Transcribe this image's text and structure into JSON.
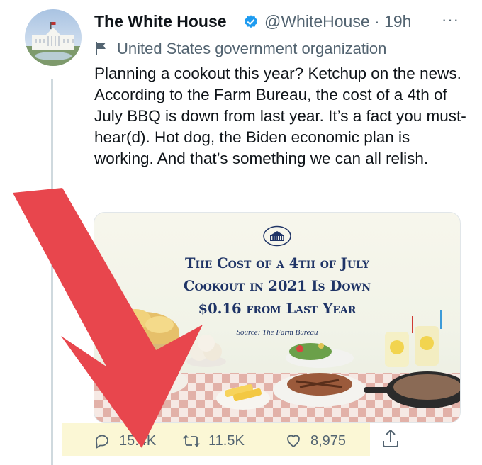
{
  "tweet": {
    "author_name": "The White House",
    "handle": "@WhiteHouse",
    "separator": "·",
    "time": "19h",
    "more_label": "···",
    "account_label": "United States government organization",
    "text": "Planning a cookout this year? Ketchup on the news. According to the Farm Bureau, the cost of a 4th of July BBQ is down from last year. It’s a fact you must-hear(d). Hot dog, the Biden economic plan is working. And that’s something we can all relish."
  },
  "media": {
    "headline_line1": "The Cost of a 4th of July",
    "headline_line2": "Cookout in 2021 Is Down",
    "headline_line3": "$0.16 from Last Year",
    "source_label": "Source:",
    "source_value": "The Farm Bureau"
  },
  "actions": {
    "replies": "15.4K",
    "retweets": "11.5K",
    "likes": "8,975"
  },
  "colors": {
    "verified": "#1d9bf0",
    "muted_text": "#536471",
    "headline": "#1f3466",
    "arrow": "#e8464d",
    "highlight": "#fbf7d5"
  },
  "icons": [
    "verified-badge-icon",
    "flag-icon",
    "reply-icon",
    "retweet-icon",
    "like-icon",
    "share-icon",
    "white-house-emblem-icon",
    "red-arrow-annotation"
  ]
}
